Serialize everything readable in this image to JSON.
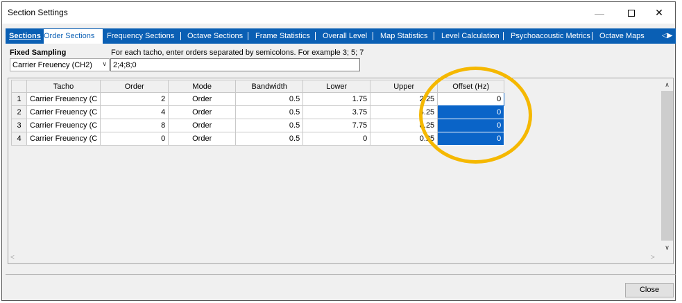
{
  "window": {
    "title": "Section Settings",
    "minimize_symbol": "—",
    "close_symbol": "✕"
  },
  "tabs": {
    "sections_label": "Sections",
    "items": [
      {
        "label": "Order Sections",
        "active": true
      },
      {
        "label": "Frequency Sections"
      },
      {
        "label": "Octave Sections"
      },
      {
        "label": "Frame Statistics"
      },
      {
        "label": "Overall Level"
      },
      {
        "label": "Map Statistics"
      },
      {
        "label": "Level Calculation"
      },
      {
        "label": "Psychoacoustic Metrics"
      },
      {
        "label": "Octave Maps"
      }
    ],
    "scroll_arrows": "◁▶"
  },
  "fixed_sampling": {
    "label": "Fixed Sampling",
    "selected": "Carrier Freuency (CH2)",
    "dropdown_arrow": "∨"
  },
  "instructions": "For each tacho, enter orders separated by semicolons. For example 3; 5; 7",
  "orders_input": {
    "value": "2;4;8;0"
  },
  "grid": {
    "columns": [
      "Tacho",
      "Order",
      "Mode",
      "Bandwidth",
      "Lower",
      "Upper",
      "Offset (Hz)"
    ],
    "rows": [
      {
        "num": "1",
        "tacho": "Carrier Freuency (C",
        "order": "2",
        "mode": "Order",
        "bandwidth": "0.5",
        "lower": "1.75",
        "upper": "2.25",
        "offset": "0"
      },
      {
        "num": "2",
        "tacho": "Carrier Freuency (C",
        "order": "4",
        "mode": "Order",
        "bandwidth": "0.5",
        "lower": "3.75",
        "upper": "4.25",
        "offset": "0"
      },
      {
        "num": "3",
        "tacho": "Carrier Freuency (C",
        "order": "8",
        "mode": "Order",
        "bandwidth": "0.5",
        "lower": "7.75",
        "upper": "8.25",
        "offset": "0"
      },
      {
        "num": "4",
        "tacho": "Carrier Freuency (C",
        "order": "0",
        "mode": "Order",
        "bandwidth": "0.5",
        "lower": "0",
        "upper": "0.25",
        "offset": "0"
      }
    ]
  },
  "scroll": {
    "up": "∧",
    "down": "∨",
    "left": "<",
    "right": ">"
  },
  "buttons": {
    "close_label": "Close"
  },
  "colors": {
    "tab_bar": "#0a5fb4",
    "selection": "#0a64c8",
    "highlight_ring": "#f5b800"
  }
}
